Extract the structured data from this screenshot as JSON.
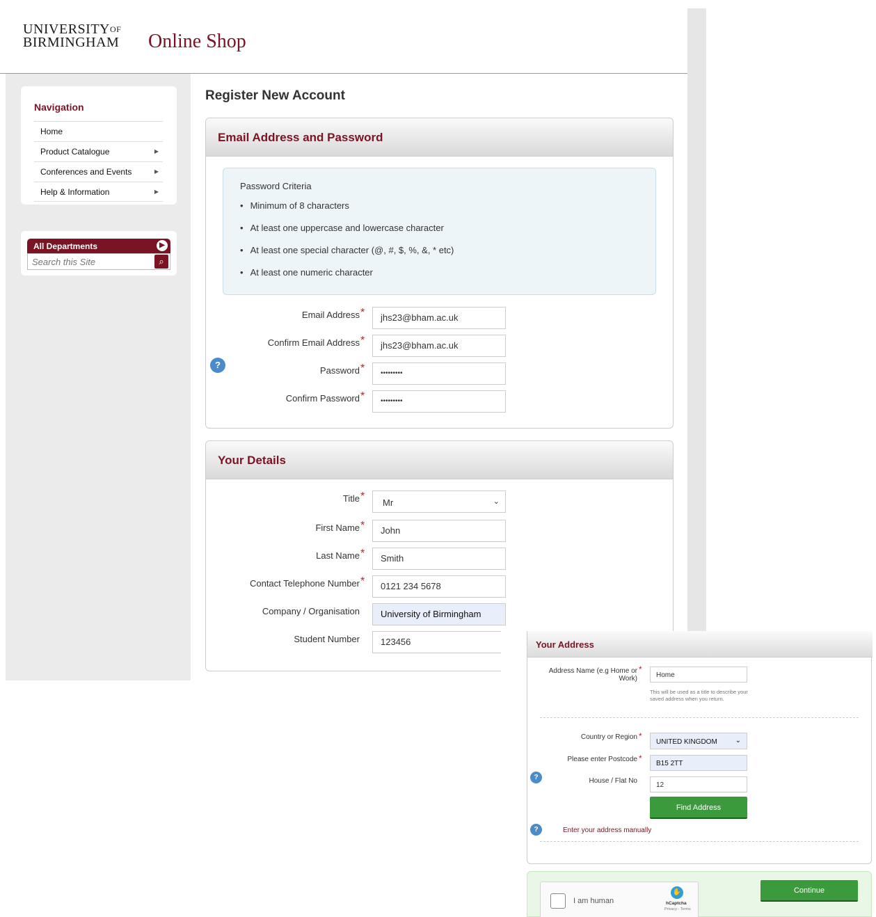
{
  "header": {
    "university_line1": "UNIVERSITY",
    "university_of": "OF",
    "university_line2": "BIRMINGHAM",
    "shop_title": "Online Shop"
  },
  "sidebar": {
    "nav_title": "Navigation",
    "items": [
      {
        "label": "Home",
        "has_arrow": false
      },
      {
        "label": "Product Catalogue",
        "has_arrow": true
      },
      {
        "label": "Conferences and Events",
        "has_arrow": true
      },
      {
        "label": "Help & Information",
        "has_arrow": true
      }
    ],
    "departments_label": "All Departments",
    "search_placeholder": "Search this Site"
  },
  "page_title": "Register New Account",
  "email_section": {
    "title": "Email Address and Password",
    "criteria_title": "Password Criteria",
    "criteria": [
      "Minimum of 8 characters",
      "At least one uppercase and lowercase character",
      "At least one special character (@, #, $, %, &, * etc)",
      "At least one numeric character"
    ],
    "email_label": "Email Address",
    "email_value": "jhs23@bham.ac.uk",
    "confirm_email_label": "Confirm Email Address",
    "confirm_email_value": "jhs23@bham.ac.uk",
    "password_label": "Password",
    "password_value": "•••••••••",
    "confirm_password_label": "Confirm Password",
    "confirm_password_value": "•••••••••"
  },
  "details_section": {
    "title": "Your Details",
    "title_label": "Title",
    "title_value": "Mr",
    "first_name_label": "First Name",
    "first_name_value": "John",
    "last_name_label": "Last Name",
    "last_name_value": "Smith",
    "phone_label": "Contact Telephone Number",
    "phone_value": "0121 234 5678",
    "company_label": "Company / Organisation",
    "company_value": "University of Birmingham",
    "student_label": "Student Number",
    "student_value": "123456"
  },
  "address_section": {
    "title": "Your Address",
    "address_name_label_1": "Address Name (e.g Home or",
    "address_name_label_2": "Work)",
    "address_name_value": "Home",
    "address_name_hint_1": "This will be used as a title to describe your",
    "address_name_hint_2": "saved address when you return.",
    "country_label": "Country or Region",
    "country_value": "UNITED KINGDOM",
    "postcode_label": "Please enter Postcode",
    "postcode_value": "B15 2TT",
    "house_label": "House / Flat No",
    "house_value": "12",
    "find_button": "Find Address",
    "manual_link": "Enter your address manually"
  },
  "captcha": {
    "label": "I am human",
    "brand": "hCaptcha",
    "terms": "Privacy - Terms"
  },
  "continue_button": "Continue",
  "required_mark": "*",
  "help_mark": "?",
  "colors": {
    "brand": "#7a1425",
    "button_green": "#3b9a3b",
    "help_blue": "#4a8bc9",
    "required_red": "#cc1b1b"
  }
}
